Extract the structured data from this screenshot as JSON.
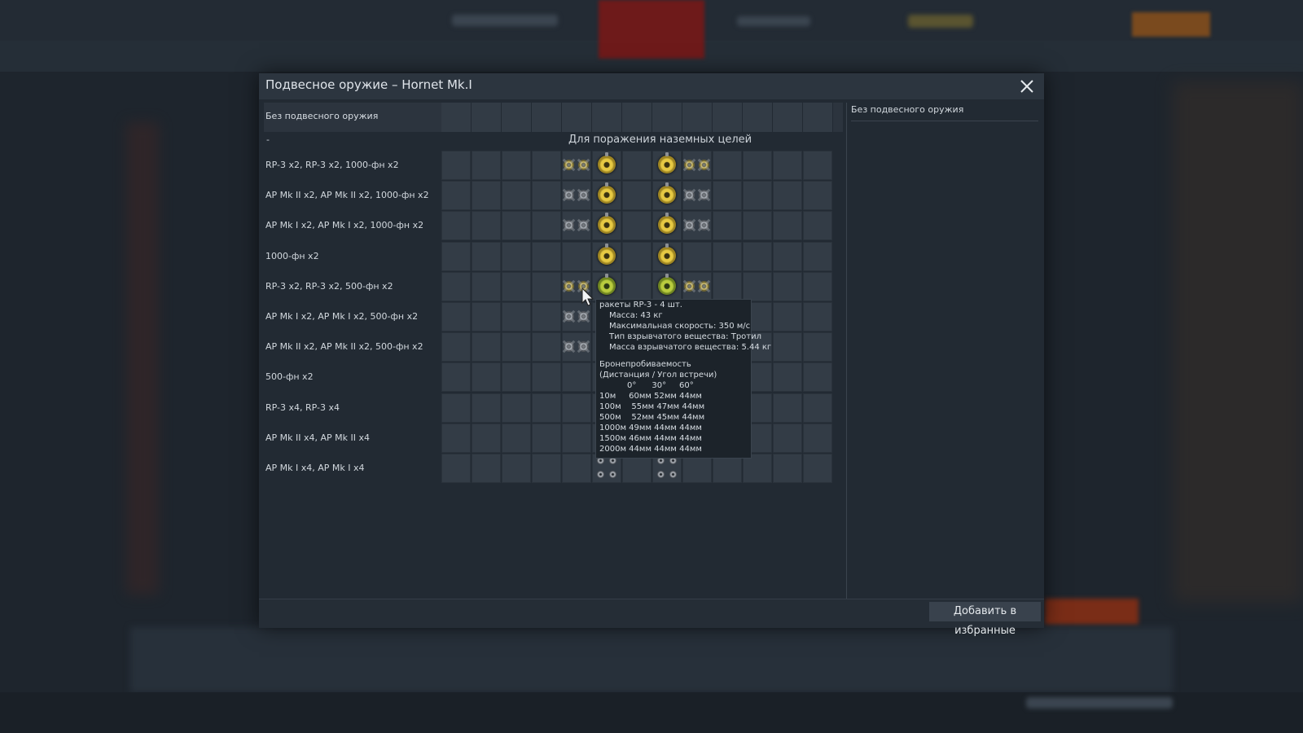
{
  "dialog": {
    "title": "Подвесное оружие – Hornet Mk.I",
    "none_label": "Без подвесного оружия",
    "dash": "-",
    "section_title": "Для поражения наземных целей",
    "description": "Без подвесного оружия",
    "favorite_button": "Добавить в избранные",
    "close_icon": "close-icon"
  },
  "rows": [
    {
      "label": "RP-3 x2,  RP-3 x2,  1000-фн x2",
      "type": "rp3_1000"
    },
    {
      "label": "AP Mk II x2,  AP Mk II x2,  1000-фн x2",
      "type": "ap_1000"
    },
    {
      "label": "AP Mk I x2,  AP Mk I x2,  1000-фн x2",
      "type": "ap_1000"
    },
    {
      "label": "1000-фн x2",
      "type": "b1000"
    },
    {
      "label": "RP-3 x2,  RP-3 x2,  500-фн x2",
      "type": "rp3_500"
    },
    {
      "label": "AP Mk I x2,  AP Mk I x2,  500-фн x2",
      "type": "ap_500"
    },
    {
      "label": "AP Mk II x2,  AP Mk II x2,  500-фн x2",
      "type": "ap_500"
    },
    {
      "label": "500-фн x2",
      "type": "b500"
    },
    {
      "label": "RP-3 x4,  RP-3 x4",
      "type": "rp3_x4"
    },
    {
      "label": "AP Mk II x4,  AP Mk II x4",
      "type": "ap_x4"
    },
    {
      "label": "AP Mk I x4,  AP Mk I x4",
      "type": "ap_x4"
    }
  ],
  "tooltip": {
    "title": "ракеты RP-3 - 4 шт.",
    "mass": "Масса: 43 кг",
    "speed": "Максимальная скорость: 350 м/с",
    "explosive": "Тип взрывчатого вещества: Тротил",
    "explosive_mass": "Масса взрывчатого вещества: 5.44 кг",
    "pen_title": "Бронепробиваемость",
    "pen_sub": "(Дистанция / Угол встречи)",
    "angles": "0°      30°     60°",
    "pen_rows": [
      "10м     60мм 52мм 44мм",
      "100м    55мм 47мм 44мм",
      "500м    52мм 45мм 44мм",
      "1000м 49мм 44мм 44мм",
      "1500м 46мм 44мм 44мм",
      "2000м 44мм 44мм 44мм"
    ]
  }
}
